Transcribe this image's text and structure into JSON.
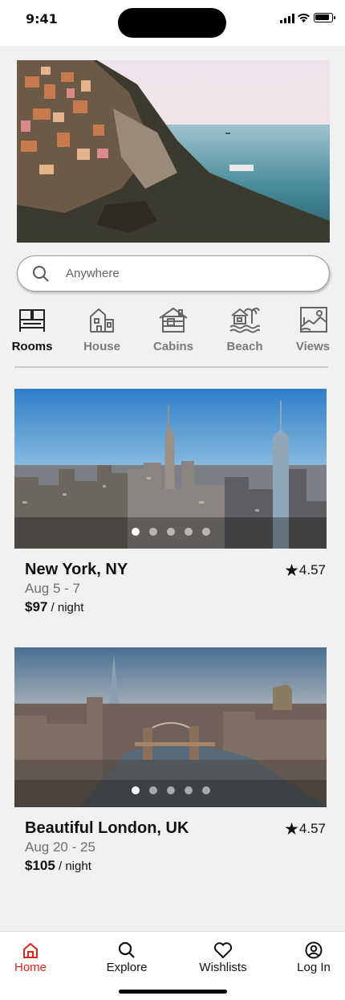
{
  "status_bar": {
    "time": "9:41"
  },
  "search": {
    "placeholder": "Anywhere"
  },
  "categories": [
    {
      "label": "Rooms",
      "icon": "bed-icon",
      "active": true
    },
    {
      "label": "House",
      "icon": "house-icon",
      "active": false
    },
    {
      "label": "Cabins",
      "icon": "cabin-icon",
      "active": false
    },
    {
      "label": "Beach",
      "icon": "beach-icon",
      "active": false
    },
    {
      "label": "Views",
      "icon": "view-picture-icon",
      "active": false
    }
  ],
  "listings": [
    {
      "title": "New York, NY",
      "dates": "Aug 5 - 7",
      "price": "$97",
      "price_unit": "/ night",
      "rating": "4.57",
      "photo_count": 5,
      "active_photo": 1
    },
    {
      "title": "Beautiful London, UK",
      "dates": "Aug 20 - 25",
      "price": "$105",
      "price_unit": "/ night",
      "rating": "4.57",
      "photo_count": 5,
      "active_photo": 1
    }
  ],
  "tabs": [
    {
      "label": "Home",
      "icon": "home-icon",
      "active": true
    },
    {
      "label": "Explore",
      "icon": "search-icon",
      "active": false
    },
    {
      "label": "Wishlists",
      "icon": "heart-icon",
      "active": false
    },
    {
      "label": "Log In",
      "icon": "user-circle-icon",
      "active": false
    }
  ],
  "colors": {
    "accent": "#e2231a",
    "background": "#f1f1f1"
  }
}
